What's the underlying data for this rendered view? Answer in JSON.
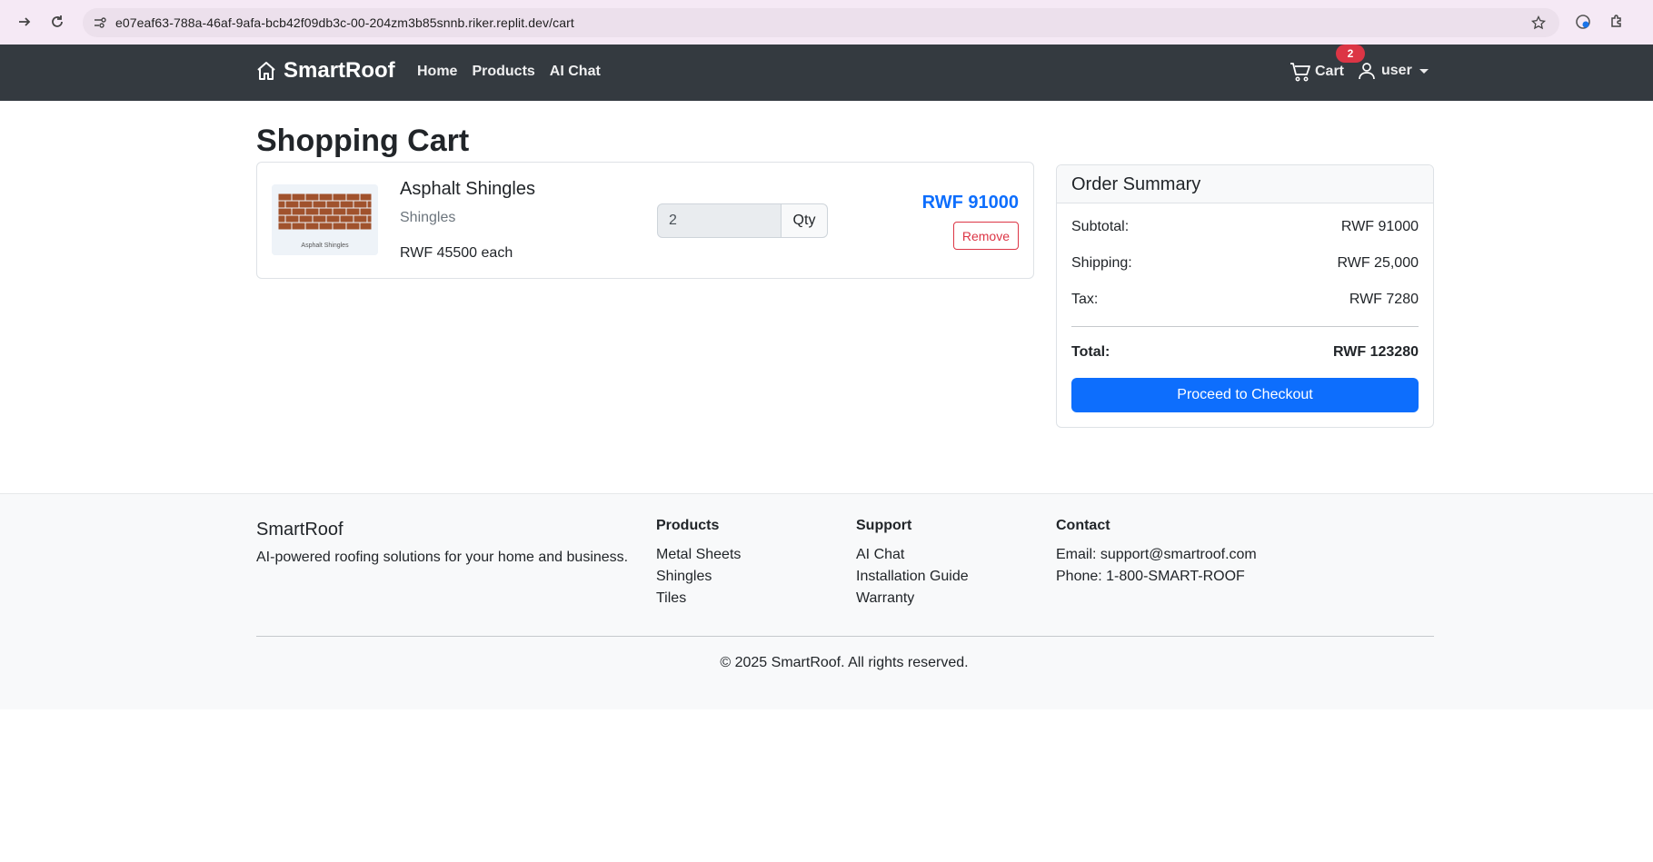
{
  "browser": {
    "url": "e07eaf63-788a-46af-9afa-bcb42f09db3c-00-204zm3b85snnb.riker.replit.dev/cart"
  },
  "navbar": {
    "brand": "SmartRoof",
    "links": [
      "Home",
      "Products",
      "AI Chat"
    ],
    "cart_label": "Cart",
    "cart_count": "2",
    "user_label": "user"
  },
  "page": {
    "title": "Shopping Cart"
  },
  "cart": {
    "items": [
      {
        "image_label": "Asphalt Shingles",
        "name": "Asphalt Shingles",
        "category": "Shingles",
        "unit_price": "RWF 45500 each",
        "quantity": "2",
        "qty_label": "Qty",
        "line_total": "RWF 91000",
        "remove_label": "Remove"
      }
    ]
  },
  "summary": {
    "title": "Order Summary",
    "subtotal_label": "Subtotal:",
    "subtotal_value": "RWF 91000",
    "shipping_label": "Shipping:",
    "shipping_value": "RWF 25,000",
    "tax_label": "Tax:",
    "tax_value": "RWF 7280",
    "total_label": "Total:",
    "total_value": "RWF 123280",
    "checkout_label": "Proceed to Checkout"
  },
  "footer": {
    "brand": "SmartRoof",
    "tagline": "AI-powered roofing solutions for your home and business.",
    "products_heading": "Products",
    "products": [
      "Metal Sheets",
      "Shingles",
      "Tiles"
    ],
    "support_heading": "Support",
    "support": [
      "AI Chat",
      "Installation Guide",
      "Warranty"
    ],
    "contact_heading": "Contact",
    "contact": [
      "Email: support@smartroof.com",
      "Phone: 1-800-SMART-ROOF"
    ],
    "copyright": "© 2025 SmartRoof. All rights reserved."
  },
  "colors": {
    "navbar_bg": "#343a40",
    "primary": "#0d6efd",
    "danger": "#dc3545",
    "brick": "#a0522d"
  }
}
